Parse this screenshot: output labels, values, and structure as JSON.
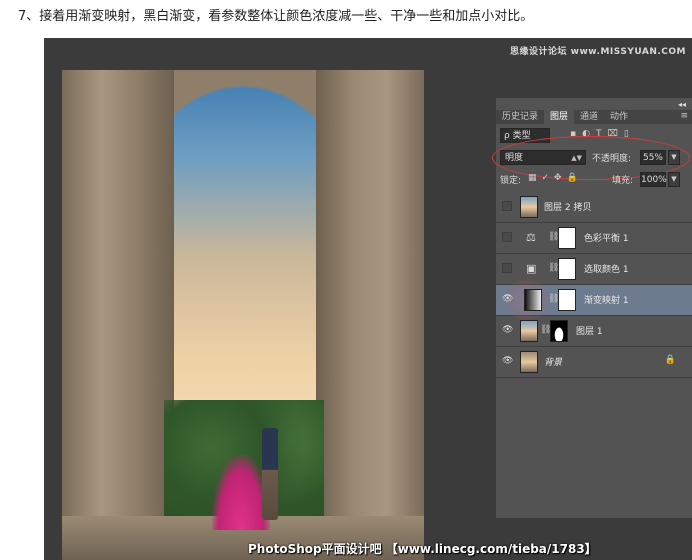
{
  "instruction": "7、接着用渐变映射，黑白渐变，看参数整体让颜色浓度减一些、干净一些和加点小对比。",
  "watermark": "思缘设计论坛 www.MISSYUAN.COM",
  "caption": "PhotoShop平面设计吧 【www.linecg.com/tieba/1783】",
  "panel": {
    "tabs": [
      {
        "label": "历史记录",
        "active": false
      },
      {
        "label": "图层",
        "active": true
      },
      {
        "label": "通道",
        "active": false
      },
      {
        "label": "动作",
        "active": false
      }
    ],
    "filter": {
      "label": "ρ 类型"
    },
    "blend_mode": "明度",
    "opacity_label": "不透明度:",
    "opacity_value": "55%",
    "lock_label": "锁定:",
    "fill_label": "填充:",
    "fill_value": "100%",
    "layers": [
      {
        "name": "图层 2 拷贝",
        "visible": false,
        "selected": false
      },
      {
        "name": "色彩平衡 1",
        "visible": false,
        "selected": false
      },
      {
        "name": "选取颜色 1",
        "visible": false,
        "selected": false
      },
      {
        "name": "渐变映射 1",
        "visible": true,
        "selected": true
      },
      {
        "name": "图层 1",
        "visible": true,
        "selected": false
      },
      {
        "name": "背景",
        "visible": true,
        "selected": false,
        "locked": true
      }
    ]
  },
  "colors": {
    "panel_bg": "#535353",
    "selected_row": "#6d7b8f",
    "highlight_ellipse": "#d73a3a"
  }
}
